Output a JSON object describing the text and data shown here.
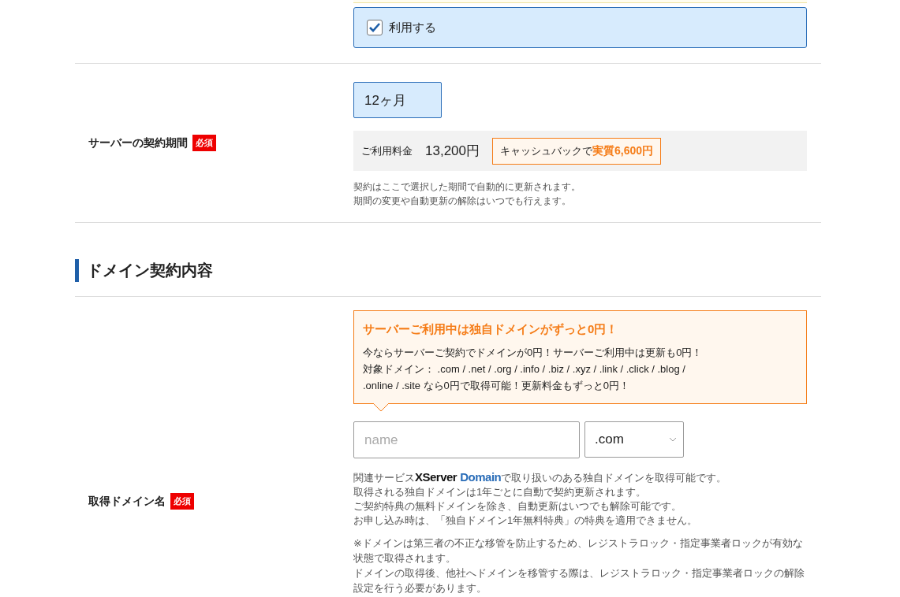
{
  "use_option": {
    "label": "利用する",
    "checked": true
  },
  "contract_term": {
    "label": "サーバーの契約期間",
    "required_badge": "必須",
    "term": "12ヶ月",
    "price_label": "ご利用料金",
    "price": "13,200円",
    "cashback_prefix": "キャッシュバックで",
    "cashback_amount": "実質6,600円",
    "notes": [
      "契約はここで選択した期間で自動的に更新されます。",
      "期間の変更や自動更新の解除はいつでも行えます。"
    ]
  },
  "section_heading": "ドメイン契約内容",
  "domain": {
    "label": "取得ドメイン名",
    "required_badge": "必須",
    "promo": {
      "title": "サーバーご利用中は独自ドメインがずっと0円！",
      "lines": [
        "今ならサーバーご契約でドメインが0円！サーバーご利用中は更新も0円！",
        "対象ドメイン： .com / .net / .org / .info / .biz / .xyz / .link / .click / .blog /",
        ".online / .site なら0円で取得可能！更新料金もずっと0円！"
      ]
    },
    "name_placeholder": "name",
    "tld": ".com",
    "related": {
      "before": "関連サービス",
      "logo_word1": "XServer",
      "logo_word2": "Domain",
      "after": "で取り扱いのある独自ドメインを取得可能です。"
    },
    "notes": [
      "取得される独自ドメインは1年ごとに自動で契約更新されます。",
      "ご契約特典の無料ドメインを除き、自動更新はいつでも解除可能です。",
      "お申し込み時は、「独自ドメイン1年無料特典」の特典を適用できません。"
    ],
    "lock_notes": [
      "※ドメインは第三者の不正な移管を防止するため、レジストラロック・指定事業者ロックが有効な状態で取得されます。",
      "ドメインの取得後、他社へドメインを移管する際は、レジストラロック・指定事業者ロックの解除設定を行う必要があります。"
    ]
  }
}
